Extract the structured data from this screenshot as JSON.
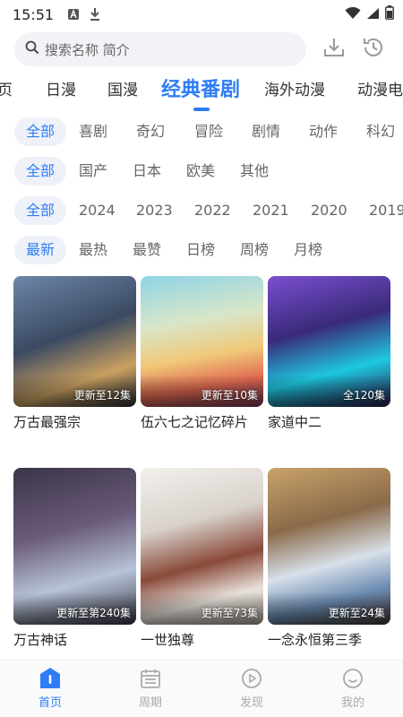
{
  "status": {
    "time": "15:51"
  },
  "search": {
    "placeholder": "搜索名称 简介"
  },
  "tabs": [
    "页",
    "日漫",
    "国漫",
    "经典番剧",
    "海外动漫",
    "动漫电"
  ],
  "filters": {
    "genre": [
      "全部",
      "喜剧",
      "奇幻",
      "冒险",
      "剧情",
      "动作",
      "科幻"
    ],
    "region": [
      "全部",
      "国产",
      "日本",
      "欧美",
      "其他"
    ],
    "year": [
      "全部",
      "2024",
      "2023",
      "2022",
      "2021",
      "2020",
      "2019"
    ],
    "sort": [
      "最新",
      "最热",
      "最赞",
      "日榜",
      "周榜",
      "月榜"
    ]
  },
  "cards": [
    {
      "title": "万古最强宗",
      "badge": "更新至12集"
    },
    {
      "title": "伍六七之记忆碎片",
      "badge": "更新至10集"
    },
    {
      "title": "家道中二",
      "badge": "全120集"
    },
    {
      "title": "万古神话",
      "badge": "更新至第240集"
    },
    {
      "title": "一世独尊",
      "badge": "更新至73集"
    },
    {
      "title": "一念永恒第三季",
      "badge": "更新至24集"
    }
  ],
  "nav": [
    {
      "label": "首页",
      "icon": "home-icon"
    },
    {
      "label": "周期",
      "icon": "calendar-icon"
    },
    {
      "label": "发现",
      "icon": "play-circle-icon"
    },
    {
      "label": "我的",
      "icon": "smile-icon"
    }
  ],
  "colors": {
    "accent": "#2f7df6",
    "chip_bg": "#eef2f8",
    "search_bg": "#f1f3f6"
  }
}
